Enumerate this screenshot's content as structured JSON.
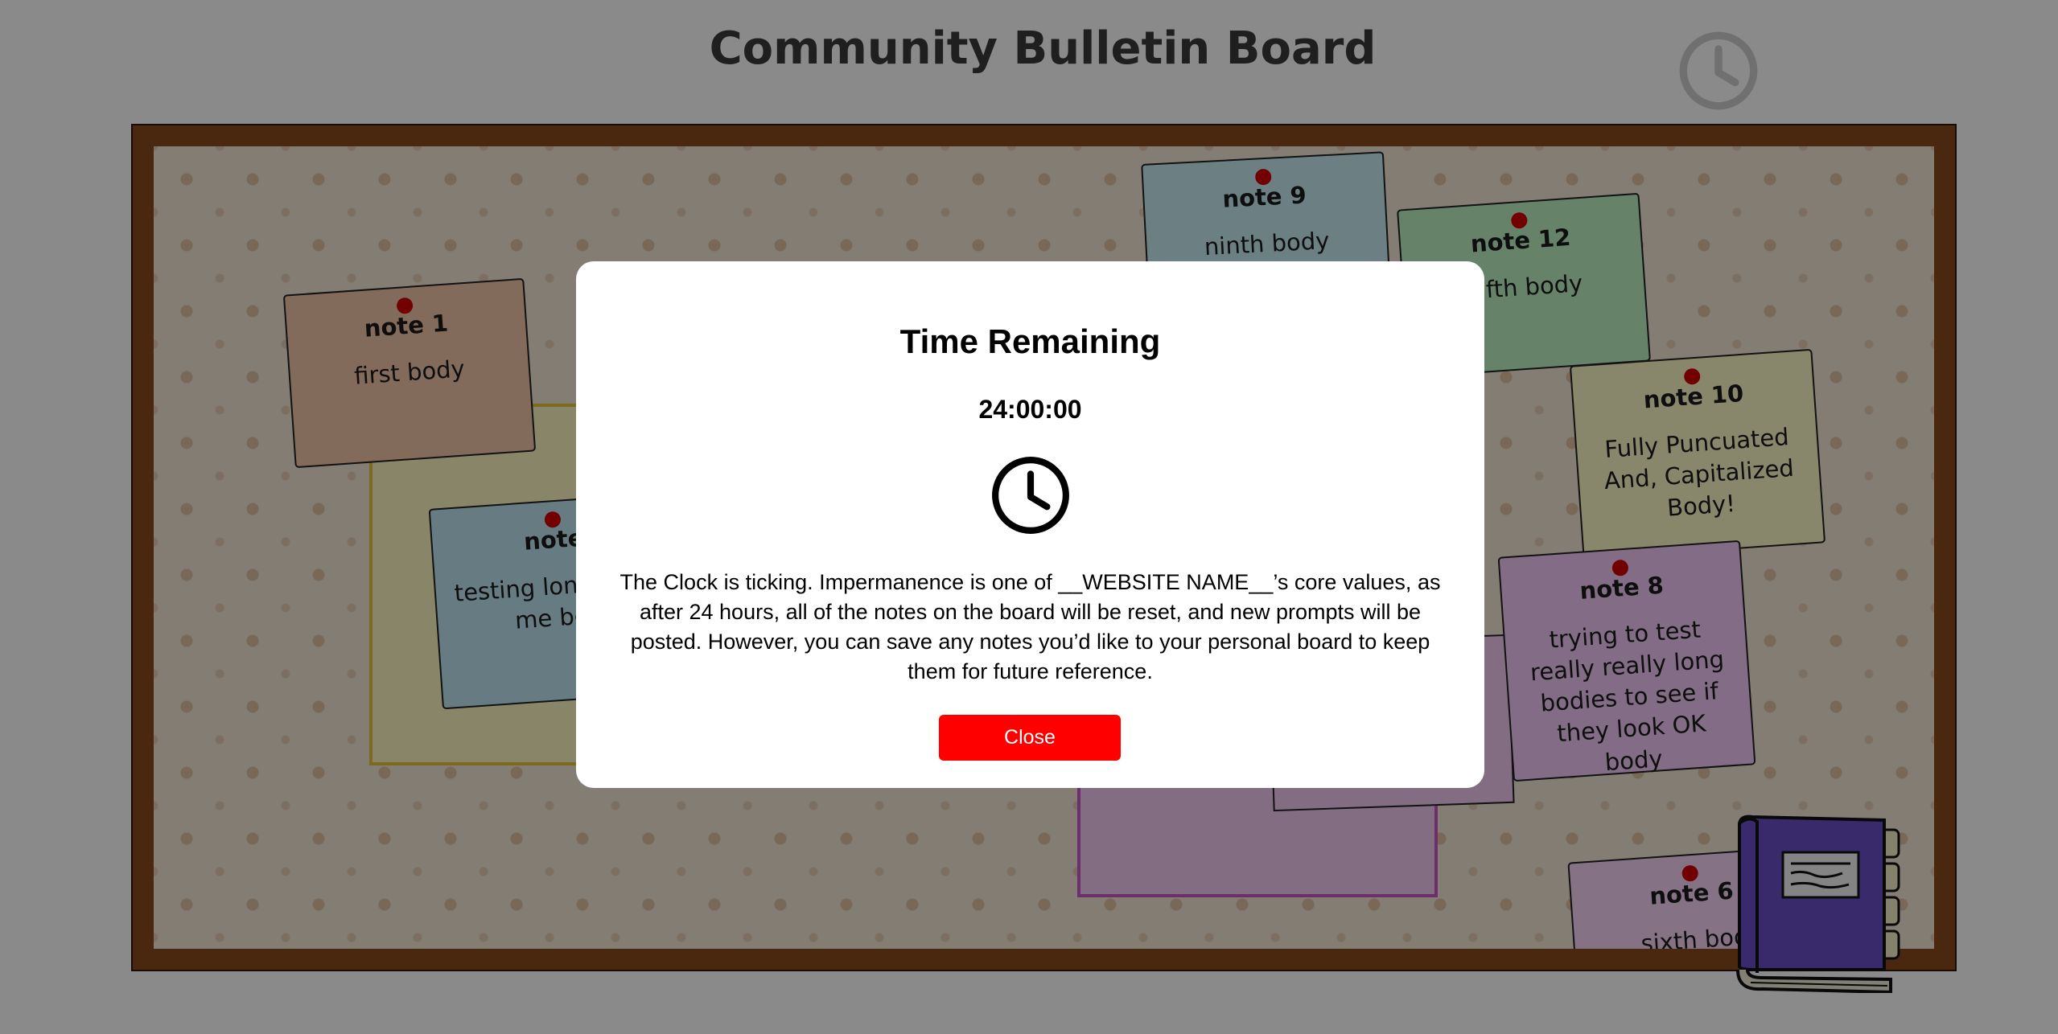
{
  "header": {
    "title": "Community Bulletin Board",
    "clock_icon": "clock-icon"
  },
  "notes": [
    {
      "title": "note 1",
      "body": "first body",
      "color": "#f3c6a8"
    },
    {
      "title": "note",
      "body": "testing lon longer me bod",
      "color": "#bfe3f1"
    },
    {
      "title": "note 9",
      "body": "ninth body",
      "color": "#c7ecf3"
    },
    {
      "title": "note 12",
      "body": "elfth body",
      "color": "#bdf2c2"
    },
    {
      "title": "note 10",
      "body": "Fully Puncuated And, Capitalized Body!",
      "color": "#fbfac6"
    },
    {
      "title": "note 8",
      "body": "trying to test really really long bodies to see if they look OK body",
      "color": "#f3c8f6"
    },
    {
      "title": "note 6",
      "body": "sixth bod",
      "color": "#f5d3f5"
    }
  ],
  "modal": {
    "title": "Time Remaining",
    "timer": "24:00:00",
    "text": "The Clock is ticking. Impermanence is one of __WEBSITE NAME__’s core values, as after 24 hours, all of the notes on the board will be reset, and new prompts will be posted. However, you can save any notes you’d like to your personal board to keep them for future reference.",
    "close_label": "Close",
    "accent_color": "#ff0000"
  },
  "notebook_icon": "notebook-icon"
}
